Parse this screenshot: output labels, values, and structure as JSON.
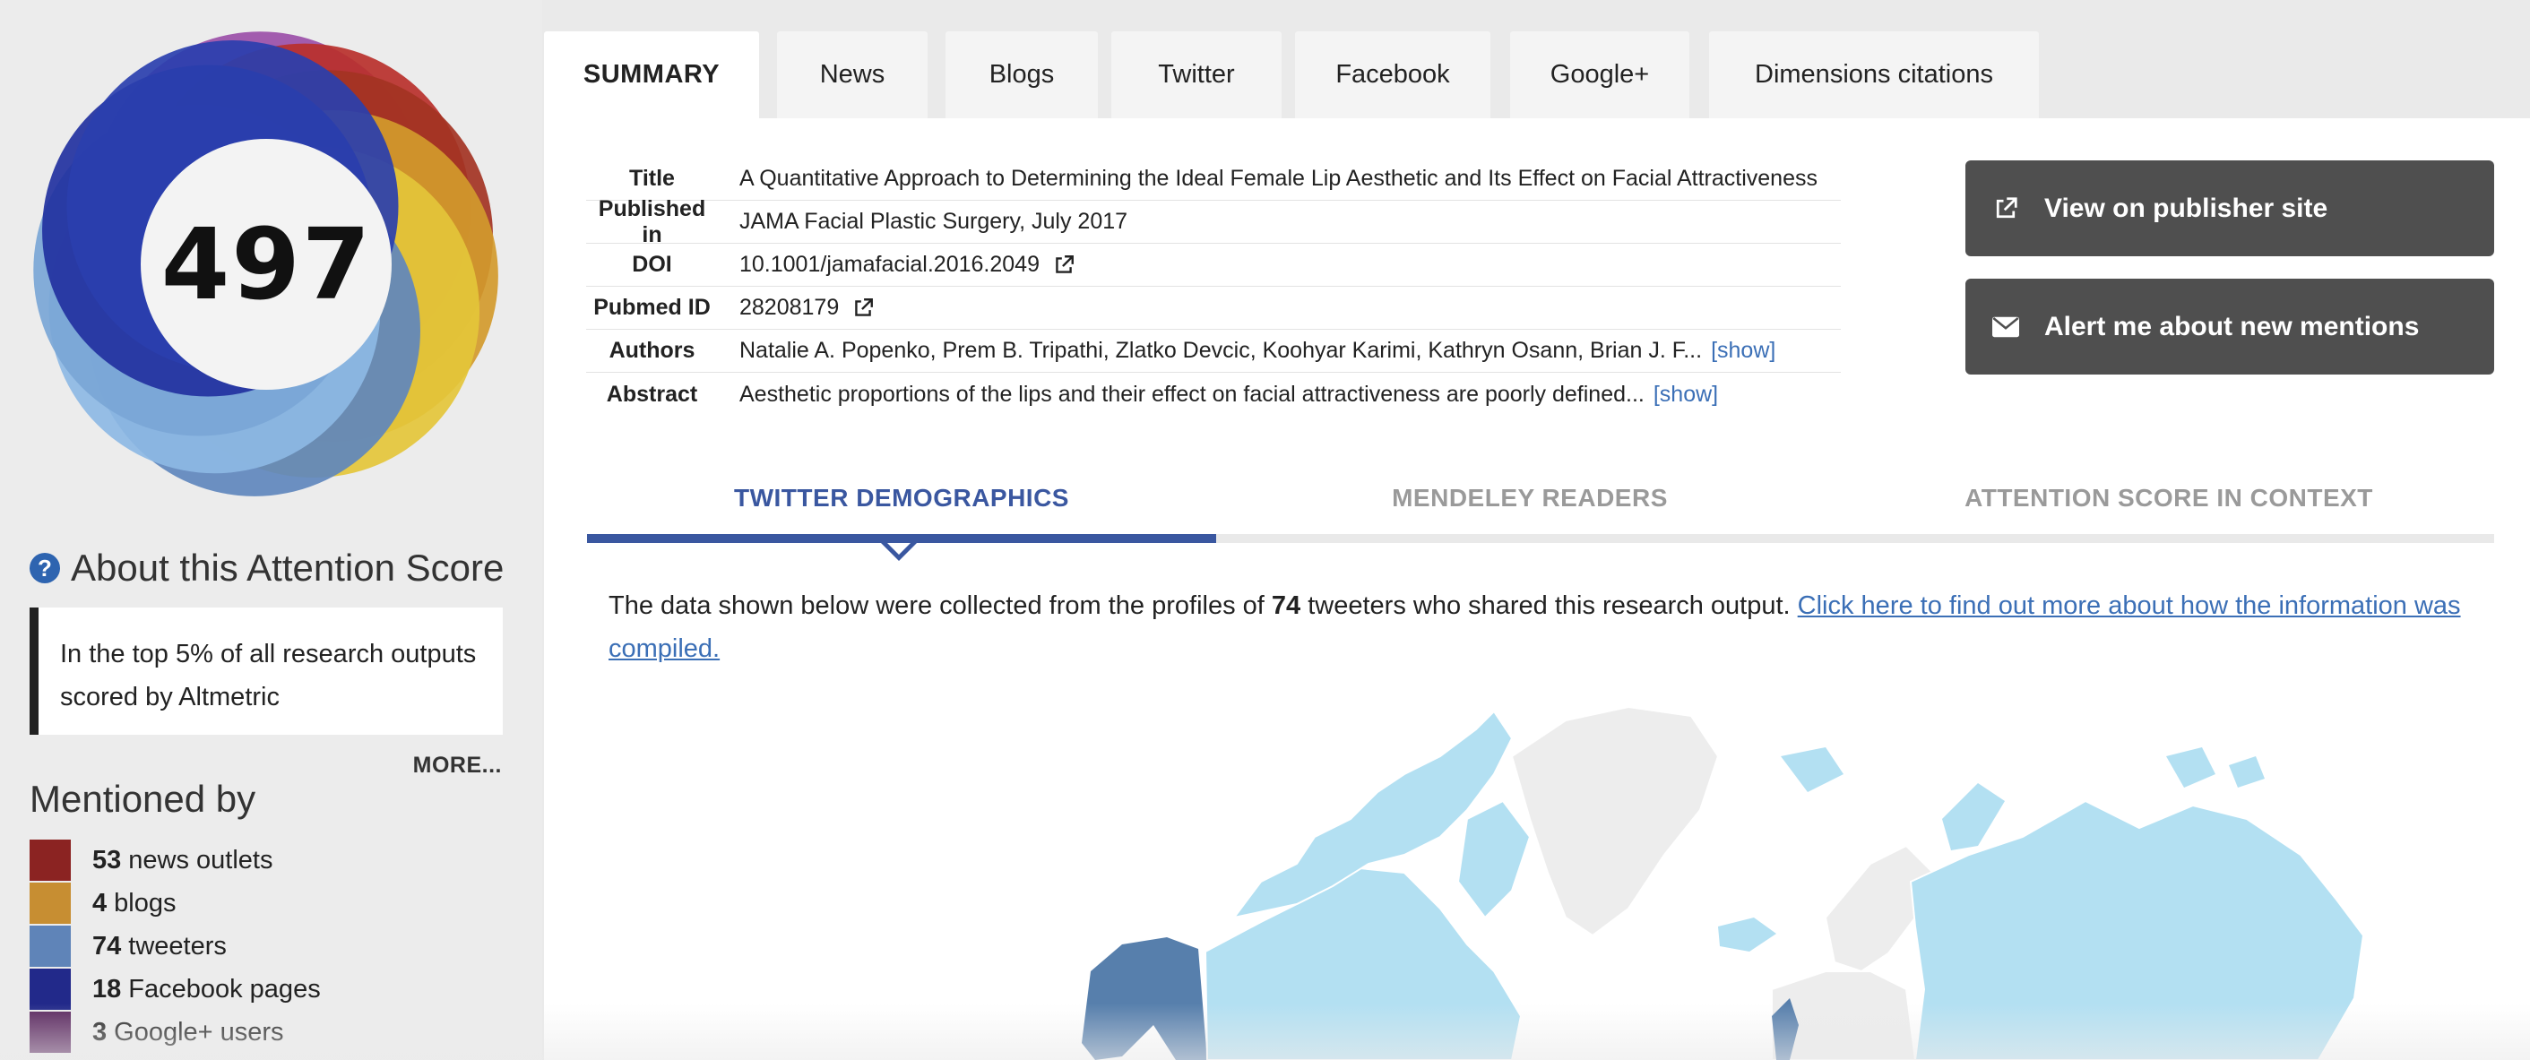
{
  "sidebar": {
    "score": "497",
    "donut_colors": [
      "#9b4fa8",
      "#b9302b",
      "#a33323",
      "#d39a2c",
      "#e4c53a",
      "#5f87bd",
      "#8db9e4",
      "#7aa6d6",
      "#2231a0",
      "#2a3fae"
    ],
    "about_title": "About this Attention Score",
    "about_text": "In the top 5% of all research outputs scored by Altmetric",
    "more_label": "MORE...",
    "mentioned_title": "Mentioned by",
    "mentions": [
      {
        "count": "53",
        "label": "news outlets",
        "color": "#8b2322"
      },
      {
        "count": "4",
        "label": "blogs",
        "color": "#c78e32"
      },
      {
        "count": "74",
        "label": "tweeters",
        "color": "#5f84b8"
      },
      {
        "count": "18",
        "label": "Facebook pages",
        "color": "#22298a"
      },
      {
        "count": "3",
        "label": "Google+ users",
        "color": "#5a275f"
      }
    ]
  },
  "tabs": {
    "summary": "SUMMARY",
    "news": "News",
    "blogs": "Blogs",
    "twitter": "Twitter",
    "facebook": "Facebook",
    "googleplus": "Google+",
    "dimensions": "Dimensions citations"
  },
  "details": {
    "title_label": "Title",
    "title": "A Quantitative Approach to Determining the Ideal Female Lip Aesthetic and Its Effect on Facial Attractiveness",
    "published_label": "Published in",
    "published": "JAMA Facial Plastic Surgery, July 2017",
    "doi_label": "DOI",
    "doi": "10.1001/jamafacial.2016.2049",
    "pubmed_label": "Pubmed ID",
    "pubmed": "28208179",
    "authors_label": "Authors",
    "authors": "Natalie A. Popenko, Prem B. Tripathi, Zlatko Devcic, Koohyar Karimi, Kathryn Osann, Brian J. F...",
    "abstract_label": "Abstract",
    "abstract": "Aesthetic proportions of the lips and their effect on facial attractiveness are poorly defined...",
    "show_label": "[show]"
  },
  "actions": {
    "publisher": "View on publisher site",
    "alert": "Alert me about new mentions"
  },
  "subtabs": {
    "twitter": "TWITTER DEMOGRAPHICS",
    "mendeley": "MENDELEY READERS",
    "context": "ATTENTION SCORE IN CONTEXT"
  },
  "twitter_info": {
    "text_before": "The data shown below were collected from the profiles of ",
    "count": "74",
    "text_after": " tweeters who shared this research output. ",
    "link": "Click here to find out more about how the information was compiled."
  },
  "colors": {
    "accent": "#3a57a0",
    "link": "#3b6fb6",
    "button": "#4f4f4f",
    "map_light": "#b3e0f2",
    "map_dark": "#577fac",
    "map_gray": "#ededed"
  }
}
